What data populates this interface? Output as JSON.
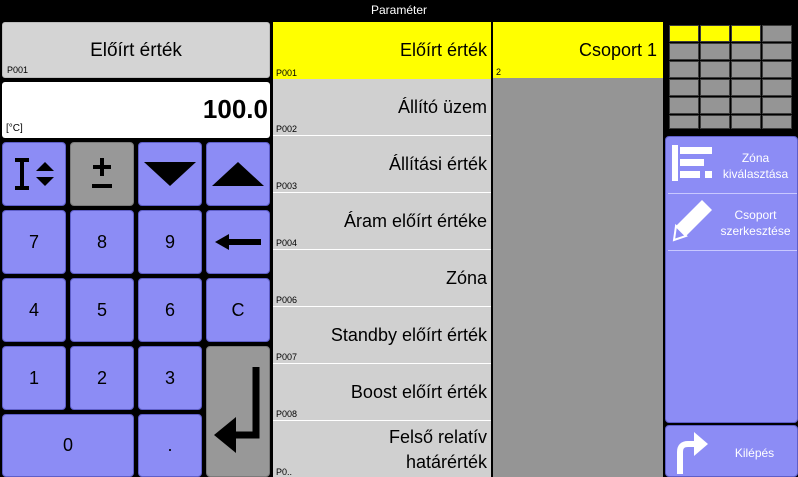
{
  "window": {
    "title": "Paraméter"
  },
  "current": {
    "name": "Előírt érték",
    "code": "P001",
    "value": "100.0",
    "unit": "[°C]"
  },
  "keypad": {
    "keys": [
      "7",
      "8",
      "9",
      "4",
      "5",
      "6",
      "C",
      "1",
      "2",
      "3",
      "0",
      "."
    ]
  },
  "params": [
    {
      "label": "Előírt érték",
      "code": "P001",
      "selected": true
    },
    {
      "label": "Állító üzem",
      "code": "P002"
    },
    {
      "label": "Állítási érték",
      "code": "P003"
    },
    {
      "label": "Áram előírt értéke",
      "code": "P004"
    },
    {
      "label": "Zóna",
      "code": "P006"
    },
    {
      "label": "Standby előírt érték",
      "code": "P007"
    },
    {
      "label": "Boost előírt érték",
      "code": "P008"
    },
    {
      "label": "Felső relatív\nhatárérték",
      "code": "P0.."
    }
  ],
  "group": {
    "label": "Csoport 1",
    "code": "2"
  },
  "actions": {
    "zone_select": "Zóna\nkiválasztása",
    "group_edit": "Csoport\nszerkesztése",
    "exit": "Kilépés"
  },
  "colors": {
    "accent": "#ffff00",
    "key": "#8c8cf5",
    "panel": "#d0d0d0"
  }
}
